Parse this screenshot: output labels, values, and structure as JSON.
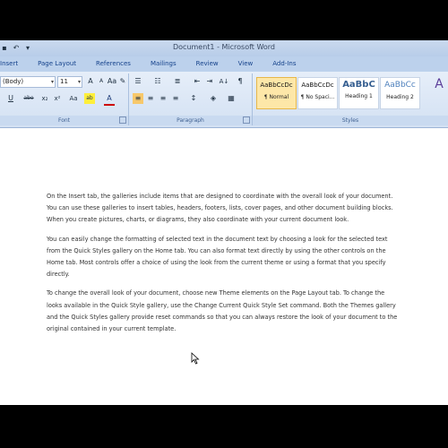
{
  "window": {
    "title": "Document1 - Microsoft Word"
  },
  "quick_access": {
    "save_icon": "save-icon",
    "undo_glyph": "↶",
    "dropdown_glyph": "▾"
  },
  "tabs": [
    "Insert",
    "Page Layout",
    "References",
    "Mailings",
    "Review",
    "View",
    "Add-Ins"
  ],
  "ribbon": {
    "font_name": "(Body)",
    "font_size": "11",
    "groups": {
      "font": "Font",
      "paragraph": "Paragraph",
      "styles": "Styles"
    },
    "font_glyphs": [
      "A",
      "A",
      "Aa",
      "✎"
    ],
    "format_glyphs": [
      "U",
      "abe",
      "x₂",
      "x²",
      "Aa",
      "ab",
      "A"
    ],
    "paragraph_glyphs": [
      "☰",
      "☷",
      "≣",
      "⇤",
      "⇥",
      "A↓",
      "¶"
    ],
    "align_glyphs": [
      "≡",
      "≡",
      "≡",
      "≡",
      "↕",
      "◈",
      "▦"
    ],
    "styles": [
      {
        "sample": "AaBbCcDc",
        "name": "¶ Normal",
        "selected": true
      },
      {
        "sample": "AaBbCcDc",
        "name": "¶ No Spaci...",
        "selected": false
      },
      {
        "sample": "AaBbC",
        "name": "Heading 1",
        "selected": false
      },
      {
        "sample": "AaBbCc",
        "name": "Heading 2",
        "selected": false
      }
    ],
    "style_more": "A"
  },
  "document": {
    "paragraphs": [
      "On the Insert tab, the galleries include items that are designed to coordinate with the overall look of your document. You can use these galleries to insert tables, headers, footers, lists, cover pages, and other document building blocks. When you create pictures, charts, or diagrams, they also coordinate with your current document look.",
      "You can easily change the formatting of selected text in the document text by choosing a look for the selected text from the Quick Styles gallery on the Home tab. You can also format text directly by using the other controls on the Home tab. Most controls offer a choice of using the look from the current theme or using a format that you specify directly.",
      "To change the overall look of your document, choose new Theme elements on the Page Layout tab. To change the looks available in the Quick Style gallery, use the Change Current Quick Style Set command. Both the Themes gallery and the Quick Styles gallery provide reset commands so that you can always restore the look of your document to the original contained in your current template."
    ]
  }
}
